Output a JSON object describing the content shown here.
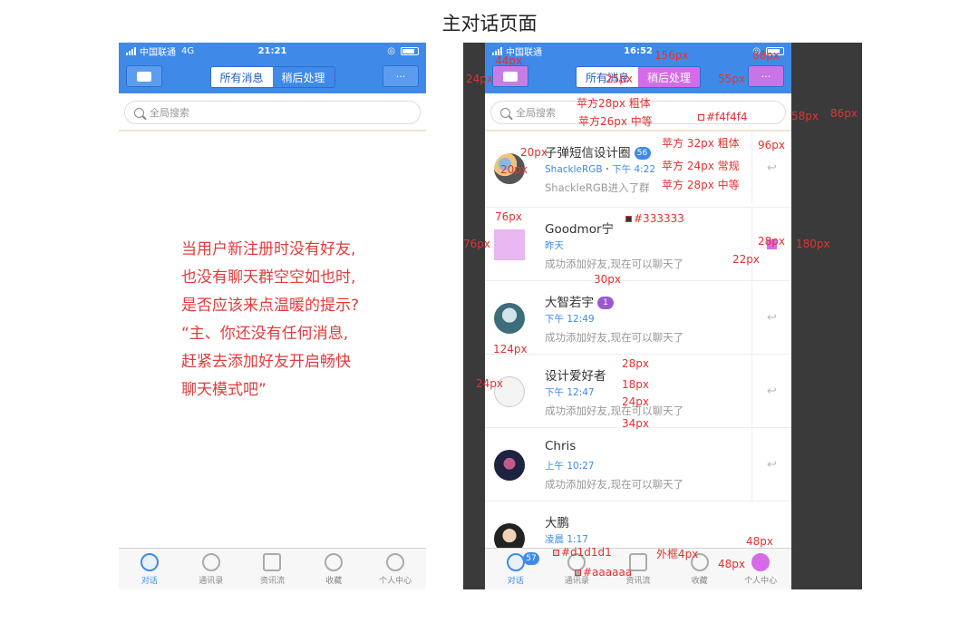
{
  "page_title": "主对话页面",
  "left_phone": {
    "status": {
      "carrier": "中国联通",
      "network": "4G",
      "time": "21:21"
    },
    "nav": {
      "left_icon": "contact-card-icon",
      "tab_all": "所有消息",
      "tab_later": "稍后处理",
      "more": "···"
    },
    "search_placeholder": "全局搜索",
    "empty_hint": [
      "当用户新注册时没有好友,",
      "也没有聊天群空空如也时,",
      "是否应该来点温暖的提示?",
      "“主、你还没有任何消息,",
      "赶紧去添加好友开启畅快",
      "聊天模式吧”"
    ],
    "tabs": [
      "对话",
      "通讯录",
      "资讯流",
      "收藏",
      "个人中心"
    ]
  },
  "right_phone": {
    "status": {
      "carrier": "中国联通",
      "time": "16:52"
    },
    "nav": {
      "tab_all": "所有消息",
      "tab_later": "稍后处理",
      "more": "···"
    },
    "search_placeholder": "全局搜索",
    "chats": [
      {
        "name": "子弹短信设计圈",
        "badge": "56",
        "time": "ShackleRGB・下午 4:22",
        "preview": "ShackleRGB进入了群"
      },
      {
        "name": "Goodmor宁",
        "time": "昨天",
        "preview": "成功添加好友,现在可以聊天了"
      },
      {
        "name": "大智若宇",
        "badge": "1",
        "time": "下午 12:49",
        "preview": "成功添加好友,现在可以聊天了"
      },
      {
        "name": "设计爱好者",
        "time": "下午 12:47",
        "preview": "成功添加好友,现在可以聊天了"
      },
      {
        "name": "Chris",
        "time": "上午 10:27",
        "preview": "成功添加好友,现在可以聊天了"
      },
      {
        "name": "大鹏",
        "time": "凌晨 1:17",
        "preview": ""
      }
    ],
    "tabs": [
      "对话",
      "通讯录",
      "资讯流",
      "收藏",
      "个人中心"
    ],
    "tab_badge": "57"
  },
  "annotations": {
    "a44": "44px",
    "a24": "24px",
    "a156": "156px",
    "a88": "88px",
    "a25": "25px",
    "a55": "55px",
    "f28b": "苹方28px 粗体",
    "f26m": "苹方26px 中等",
    "c_f4": "#f4f4f4",
    "a58": "58px",
    "a86": "86px",
    "a20": "20px",
    "a20b": "20px",
    "f32b": "苹方 32px 粗体",
    "f24r": "苹方 24px 常规",
    "f28m": "苹方 28px 中等",
    "a96": "96px",
    "a76w": "76px",
    "a76h": "76px",
    "c333": "#333333",
    "a28": "28px",
    "a22": "22px",
    "a180": "180px",
    "a30": "30px",
    "a124": "124px",
    "a28b": "28px",
    "a18": "18px",
    "a24b": "24px",
    "a24c": "24px",
    "a34": "34px",
    "c_d1": "#d1d1d1",
    "border4": "外框4px",
    "a48w": "48px",
    "a48h": "48px",
    "c_aa": "#aaaaaa"
  },
  "colors": {
    "accent": "#3f8ae8",
    "annotation": "#e23232",
    "highlight": "#d56be8"
  }
}
